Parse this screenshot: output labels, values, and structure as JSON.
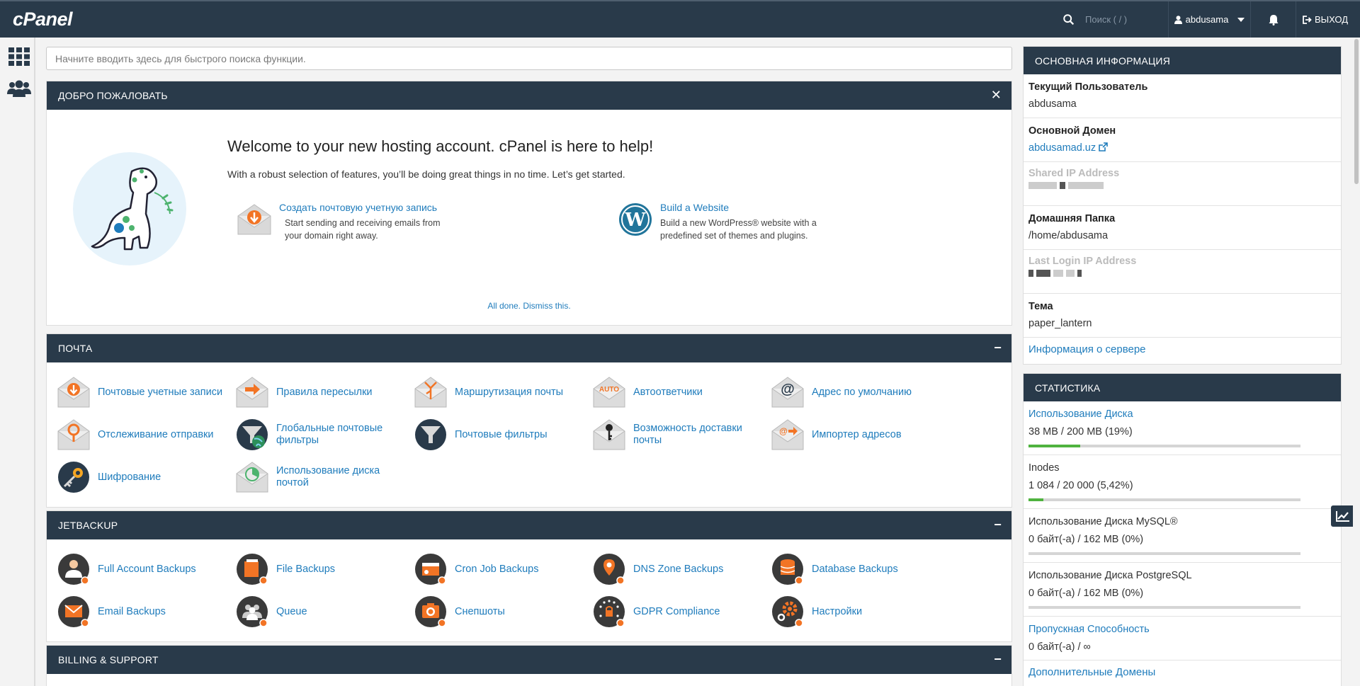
{
  "topbar": {
    "logo": "cPanel",
    "search_placeholder": "Поиск ( / )",
    "username": "abdusama",
    "logout": "ВЫХОД"
  },
  "search": {
    "placeholder": "Начните вводить здесь для быстрого поиска функции."
  },
  "welcome": {
    "header": "ДОБРО ПОЖАЛОВАТЬ",
    "title": "Welcome to your new hosting account. cPanel is here to help!",
    "subtitle": "With a robust selection of features, you’ll be doing great things in no time. Let’s get started.",
    "task1_link": "Создать почтовую учетную запись",
    "task1_desc": "Start sending and receiving emails from your domain right away.",
    "task2_link": "Build a Website",
    "task2_desc": "Build a new WordPress® website with a predefined set of themes and plugins.",
    "dismiss": "All done. Dismiss this."
  },
  "mail": {
    "header": "ПОЧТА",
    "items": [
      {
        "label": "Почтовые учетные записи",
        "icon": "envelope-download-icon"
      },
      {
        "label": "Правила пересылки",
        "icon": "envelope-forward-icon"
      },
      {
        "label": "Маршрутизация почты",
        "icon": "envelope-routing-icon"
      },
      {
        "label": "Автоответчики",
        "icon": "envelope-auto-icon"
      },
      {
        "label": "Адрес по умолчанию",
        "icon": "envelope-at-icon"
      },
      {
        "label": "Отслеживание отправки",
        "icon": "envelope-tracking-icon"
      },
      {
        "label": "Глобальные почтовые фильтры",
        "icon": "global-filter-icon"
      },
      {
        "label": "Почтовые фильтры",
        "icon": "filter-icon"
      },
      {
        "label": "Возможность доставки почты",
        "icon": "envelope-key-icon"
      },
      {
        "label": "Импортер адресов",
        "icon": "envelope-import-icon"
      },
      {
        "label": "Шифрование",
        "icon": "encryption-key-icon"
      },
      {
        "label": "Использование диска почтой",
        "icon": "envelope-disk-usage-icon"
      }
    ]
  },
  "jetbackup": {
    "header": "JETBACKUP",
    "items": [
      {
        "label": "Full Account Backups",
        "icon": "account-backup-icon"
      },
      {
        "label": "File Backups",
        "icon": "file-backup-icon"
      },
      {
        "label": "Cron Job Backups",
        "icon": "cron-backup-icon"
      },
      {
        "label": "DNS Zone Backups",
        "icon": "dns-backup-icon"
      },
      {
        "label": "Database Backups",
        "icon": "database-backup-icon"
      },
      {
        "label": "Email Backups",
        "icon": "email-backup-icon"
      },
      {
        "label": "Queue",
        "icon": "queue-icon"
      },
      {
        "label": "Снепшоты",
        "icon": "snapshot-icon"
      },
      {
        "label": "GDPR Compliance",
        "icon": "gdpr-icon"
      },
      {
        "label": "Настройки",
        "icon": "settings-icon"
      }
    ]
  },
  "billing": {
    "header": "BILLING & SUPPORT"
  },
  "general": {
    "header": "ОСНОВНАЯ ИНФОРМАЦИЯ",
    "current_user_label": "Текущий Пользователь",
    "current_user": "abdusama",
    "main_domain_label": "Основной Домен",
    "main_domain": "abdusamad.uz",
    "shared_ip_label": "Shared IP Address",
    "home_dir_label": "Домашняя Папка",
    "home_dir": "/home/abdusama",
    "last_login_label": "Last Login IP Address",
    "theme_label": "Тема",
    "theme": "paper_lantern",
    "server_info": "Информация о сервере"
  },
  "stats": {
    "header": "СТАТИСТИКА",
    "disk_label": "Использование Диска",
    "disk_value": "38 MB / 200 MB   (19%)",
    "disk_fraction": 0.19,
    "inodes_label": "Inodes",
    "inodes_value": "1 084 / 20 000   (5,42%)",
    "inodes_fraction": 0.0542,
    "mysql_label": "Использование Диска MySQL®",
    "mysql_value": "0 байт(-а) / 162 MB   (0%)",
    "mysql_fraction": 0,
    "pg_label": "Использование Диска PostgreSQL",
    "pg_value": "0 байт(-а) / 162 MB   (0%)",
    "pg_fraction": 0,
    "bandwidth_label": "Пропускная Способность",
    "bandwidth_value": "0 байт(-а) / ∞",
    "addon_label": "Дополнительные Домены"
  },
  "colors": {
    "header": "#293a4a",
    "link": "#1f7cbc",
    "accent_orange": "#f27425",
    "bar": "#4fb33f"
  }
}
